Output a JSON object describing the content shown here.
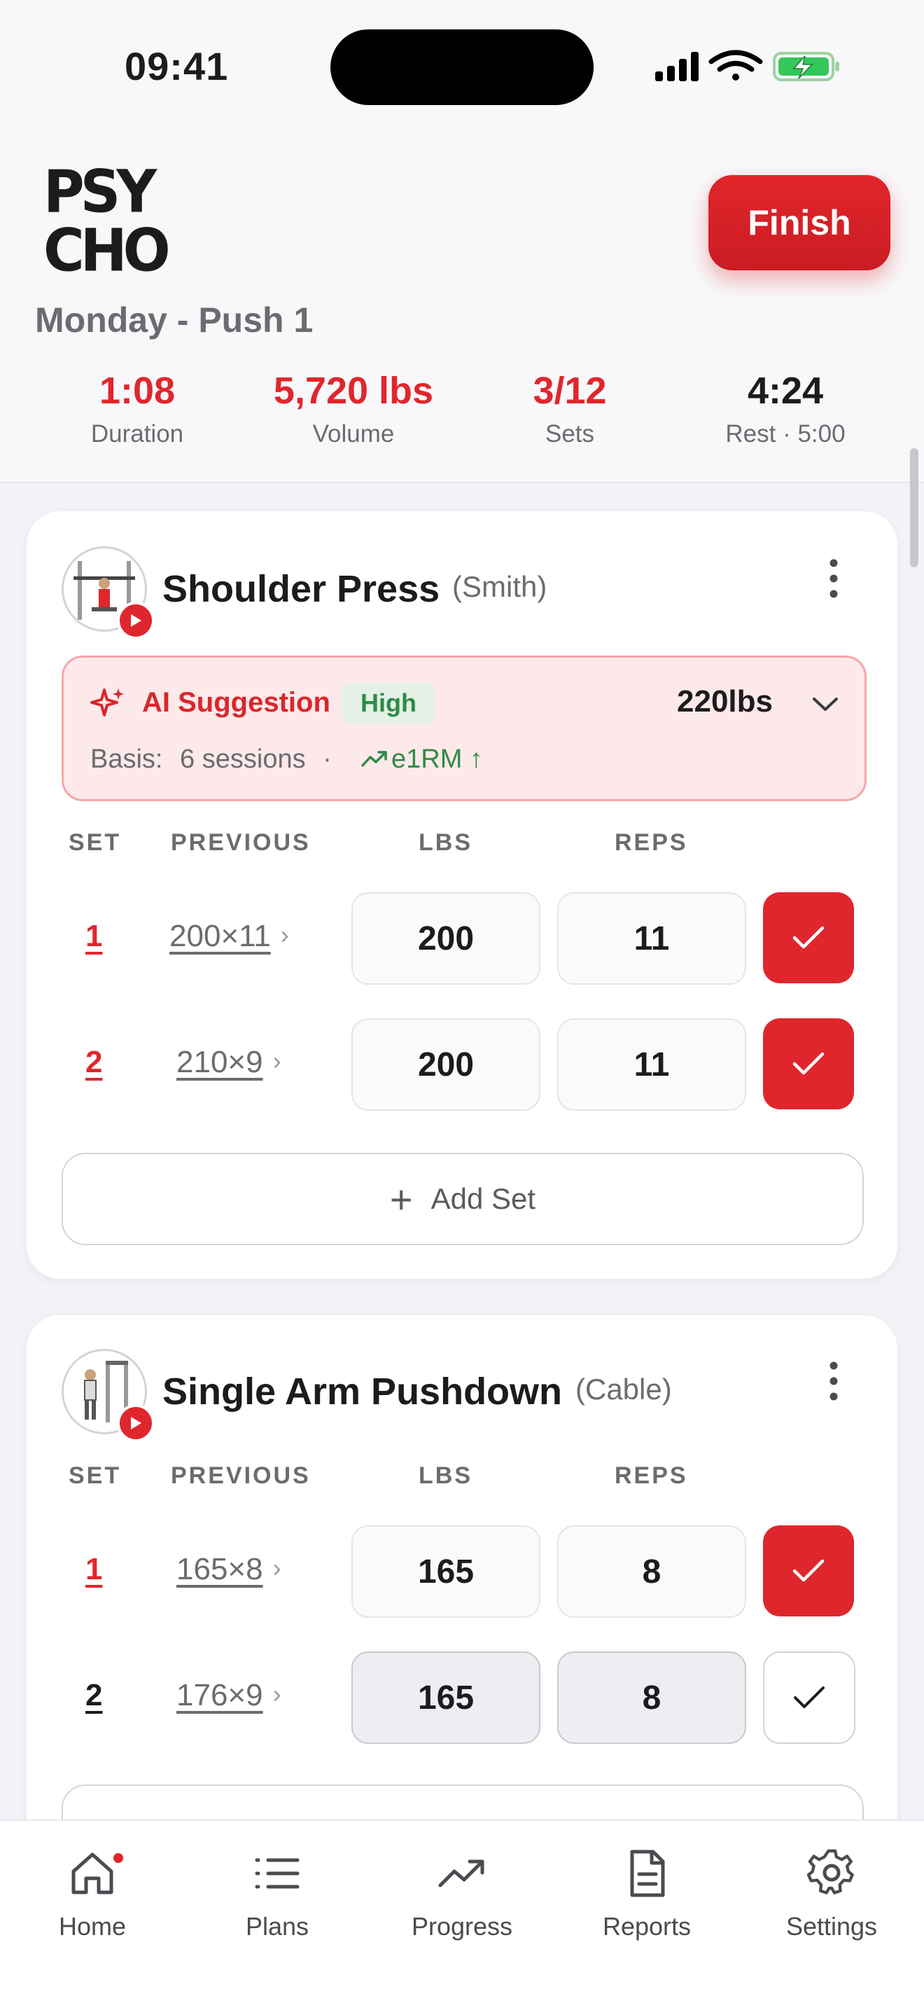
{
  "status_bar": {
    "time": "09:41"
  },
  "header": {
    "logo_lines": [
      "PSY",
      "CHO"
    ],
    "finish_label": "Finish",
    "workout_name": "Monday - Push 1",
    "stats": [
      {
        "value": "1:08",
        "label": "Duration"
      },
      {
        "value": "5,720 lbs",
        "label": "Volume"
      },
      {
        "value": "3/12",
        "label": "Sets"
      },
      {
        "value": "4:24",
        "label": "Rest · 5:00"
      }
    ]
  },
  "columns": {
    "set": "SET",
    "previous": "PREVIOUS",
    "lbs": "LBS",
    "reps": "REPS"
  },
  "exercises": [
    {
      "name": "Shoulder Press",
      "equipment": "(Smith)",
      "ai_suggestion": {
        "title": "AI Suggestion",
        "confidence": "High",
        "value": "220lbs",
        "basis_label": "Basis:",
        "basis_value": "6 sessions",
        "separator": "·",
        "trend": "e1RM ↑"
      },
      "sets": [
        {
          "set": "1",
          "previous": "200×11",
          "lbs": "200",
          "reps": "11",
          "done": true
        },
        {
          "set": "2",
          "previous": "210×9",
          "lbs": "200",
          "reps": "11",
          "done": true
        }
      ],
      "add_set_label": "Add Set"
    },
    {
      "name": "Single Arm Pushdown",
      "equipment": "(Cable)",
      "sets": [
        {
          "set": "1",
          "previous": "165×8",
          "lbs": "165",
          "reps": "8",
          "done": true
        },
        {
          "set": "2",
          "previous": "176×9",
          "lbs": "165",
          "reps": "8",
          "done": false
        }
      ]
    }
  ],
  "tabbar": [
    {
      "label": "Home",
      "icon": "home-icon",
      "badge": true
    },
    {
      "label": "Plans",
      "icon": "list-icon"
    },
    {
      "label": "Progress",
      "icon": "trend-icon"
    },
    {
      "label": "Reports",
      "icon": "document-icon"
    },
    {
      "label": "Settings",
      "icon": "gear-icon"
    }
  ],
  "colors": {
    "accent": "#e0262d",
    "success": "#2e8b47",
    "ai_bg": "#fde9e9"
  }
}
